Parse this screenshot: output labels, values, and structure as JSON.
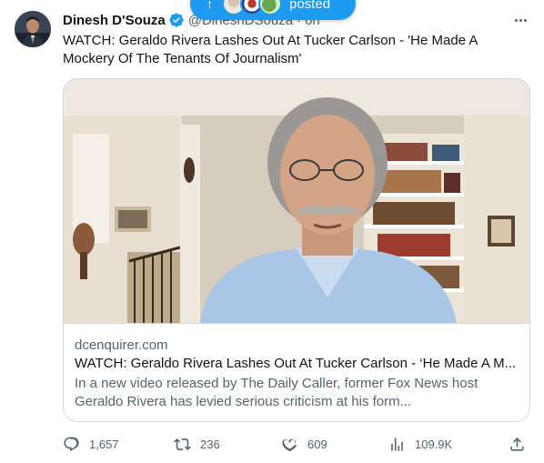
{
  "author": {
    "name": "Dinesh D'Souza",
    "handle": "@DineshDSouza",
    "separator": "·",
    "time": "6h"
  },
  "new_posts_pill": {
    "label": "posted",
    "color": "#1d9bf0"
  },
  "tweet_text": "WATCH: Geraldo Rivera Lashes Out At Tucker Carlson - 'He Made A Mockery Of The Tenants Of Journalism'",
  "card": {
    "domain": "dcenquirer.com",
    "title": "WATCH: Geraldo Rivera Lashes Out At Tucker Carlson - ‘He Made A M...",
    "description": "In a new video released by The Daily Caller, former Fox News host Geraldo Rivera has levied serious criticism at his form..."
  },
  "actions": {
    "replies": "1,657",
    "reposts": "236",
    "likes": "609",
    "views": "109.9K"
  },
  "icons": [
    "verified-icon",
    "more-icon",
    "reply-icon",
    "repost-icon",
    "like-icon",
    "views-icon",
    "share-icon",
    "arrow-up-icon"
  ],
  "colors": {
    "accent": "#1d9bf0",
    "text_primary": "#0f1419",
    "text_secondary": "#536471",
    "border": "#cfd9de"
  }
}
